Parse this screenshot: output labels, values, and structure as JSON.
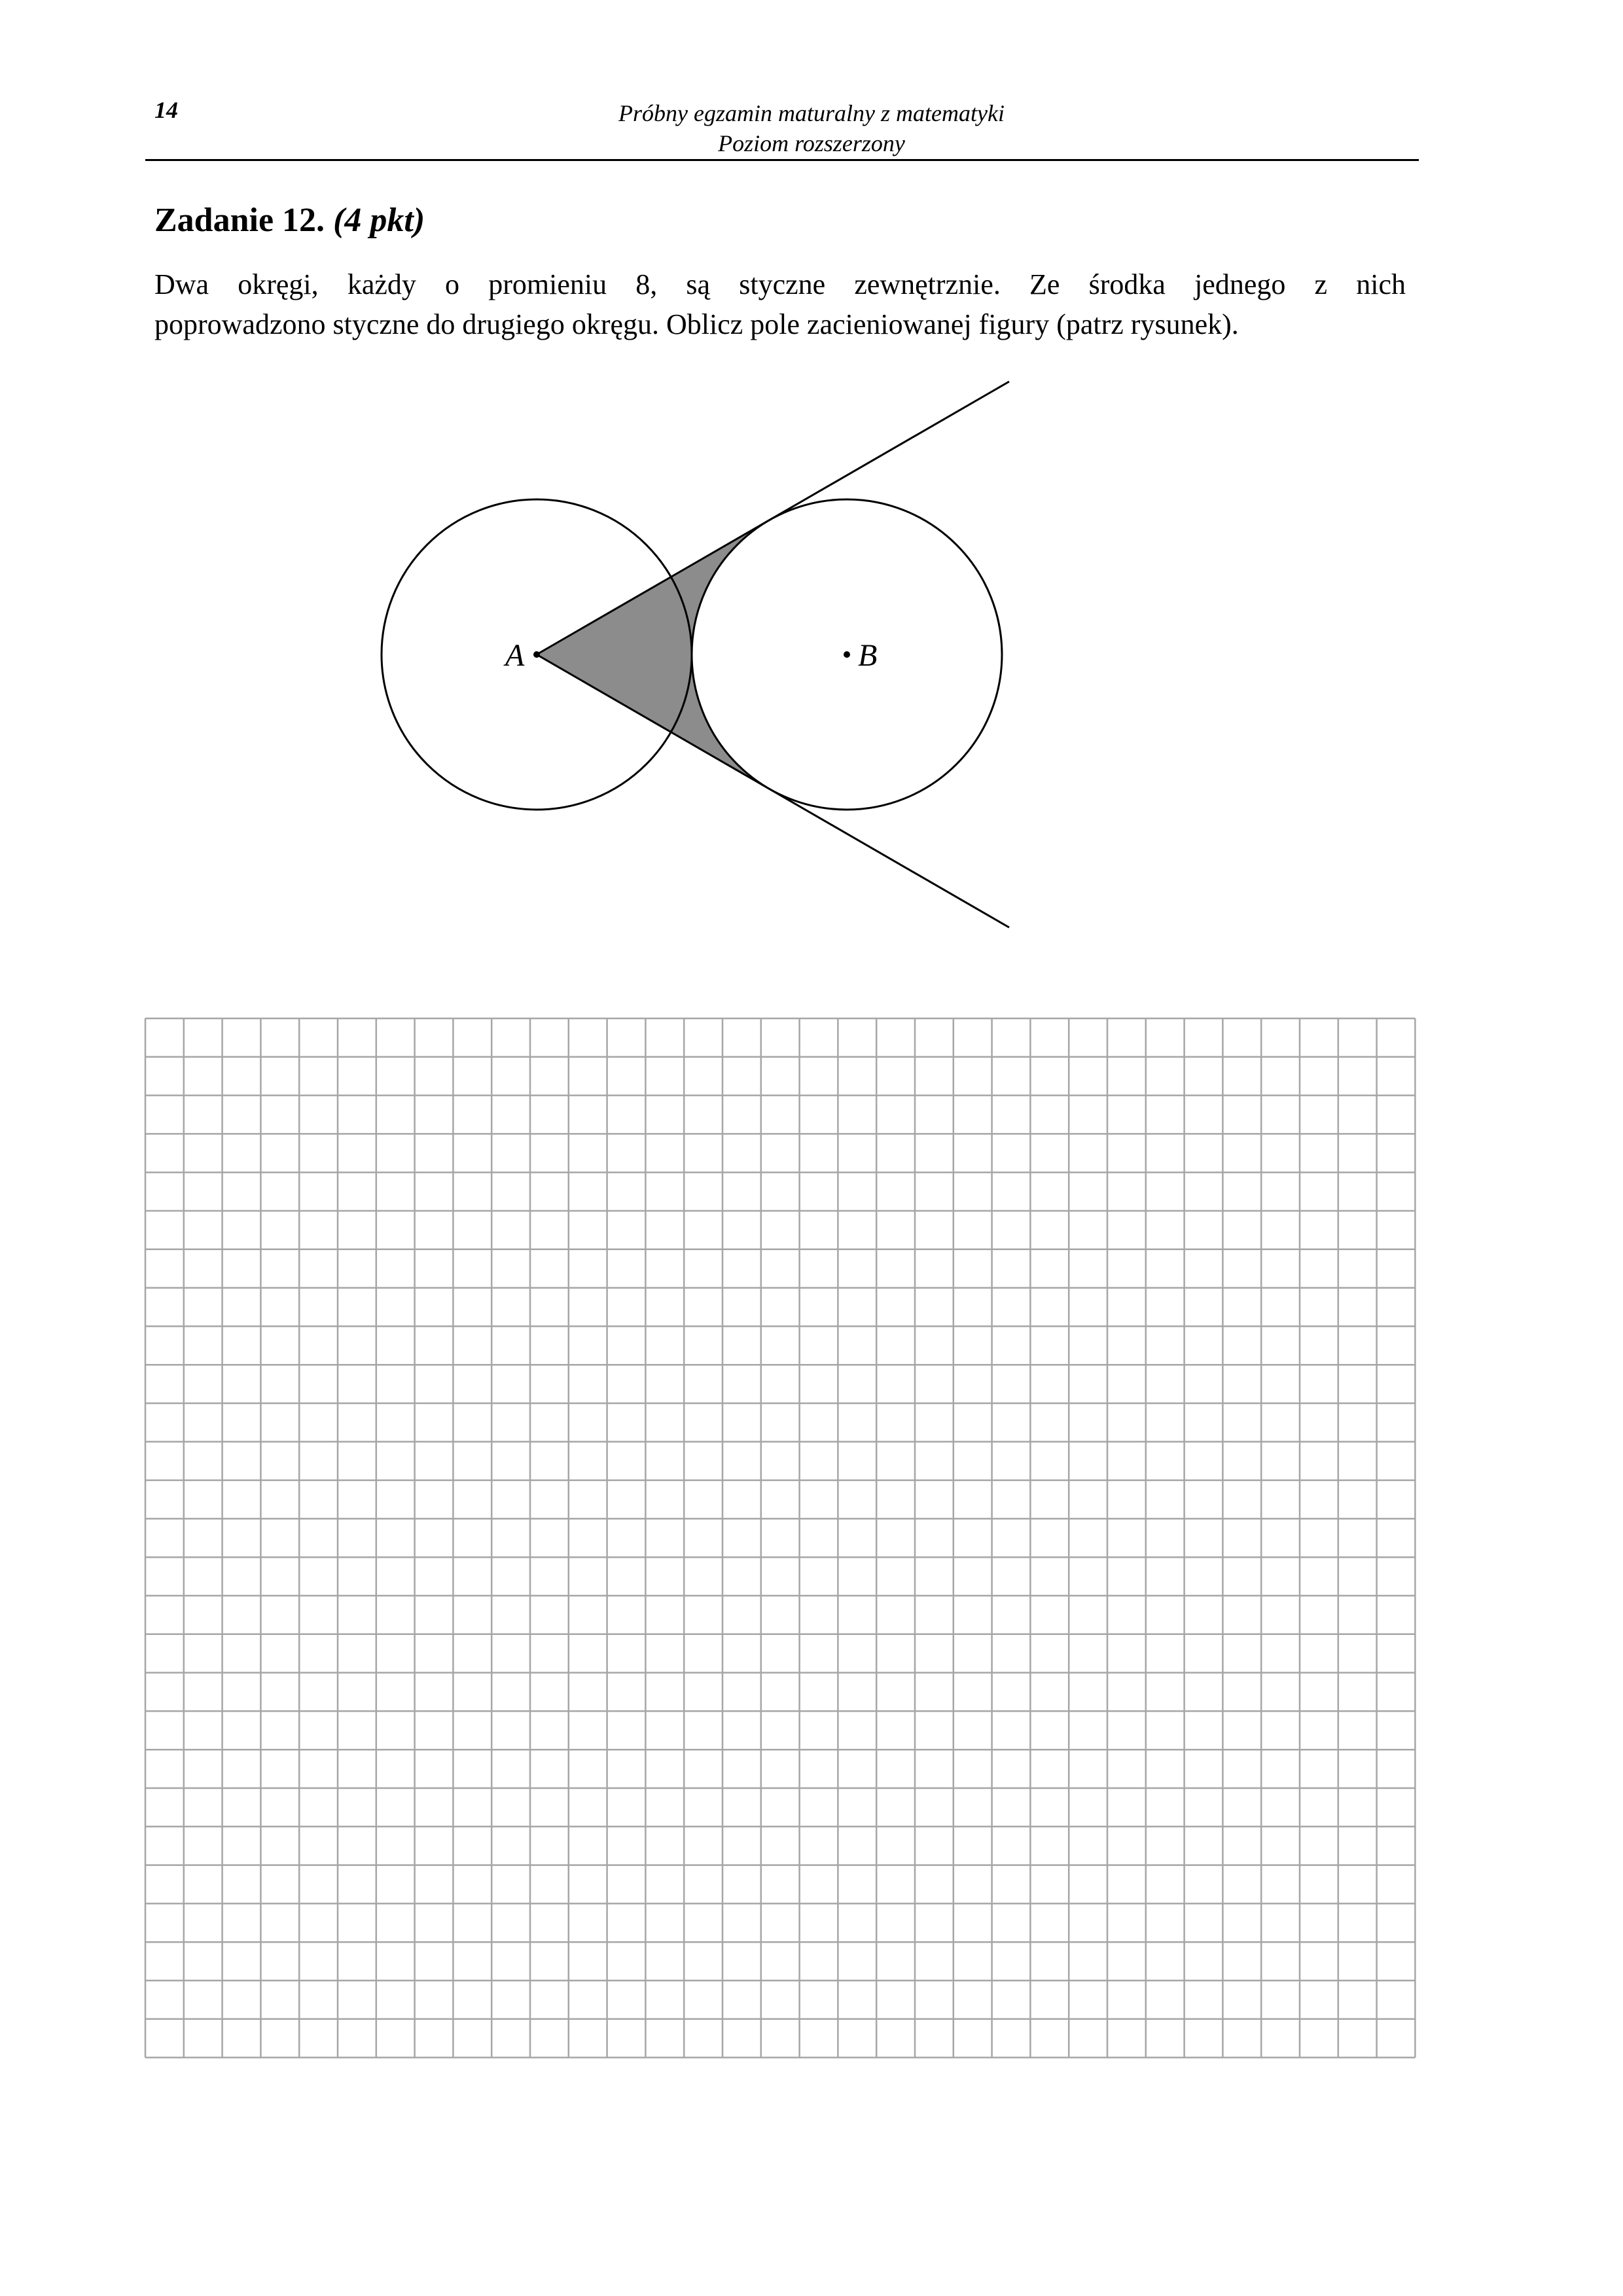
{
  "header": {
    "page_number": "14",
    "title_line1": "Próbny egzamin maturalny z matematyki",
    "title_line2": "Poziom rozszerzony"
  },
  "task": {
    "label": "Zadanie 12.",
    "points": "(4 pkt)",
    "text_line1": "Dwa okręgi, każdy o promieniu 8, są styczne zewnętrznie. Ze środka jednego z nich",
    "text_line2": "poprowadzono styczne do drugiego okręgu. Oblicz pole zacieniowanej figury (patrz rysunek)."
  },
  "figure": {
    "point_a_label": "A",
    "point_b_label": "B",
    "shade_color": "#8c8c8c"
  },
  "answer_grid": {
    "columns": 33,
    "rows": 27,
    "line_color": "#a6a6a6"
  }
}
